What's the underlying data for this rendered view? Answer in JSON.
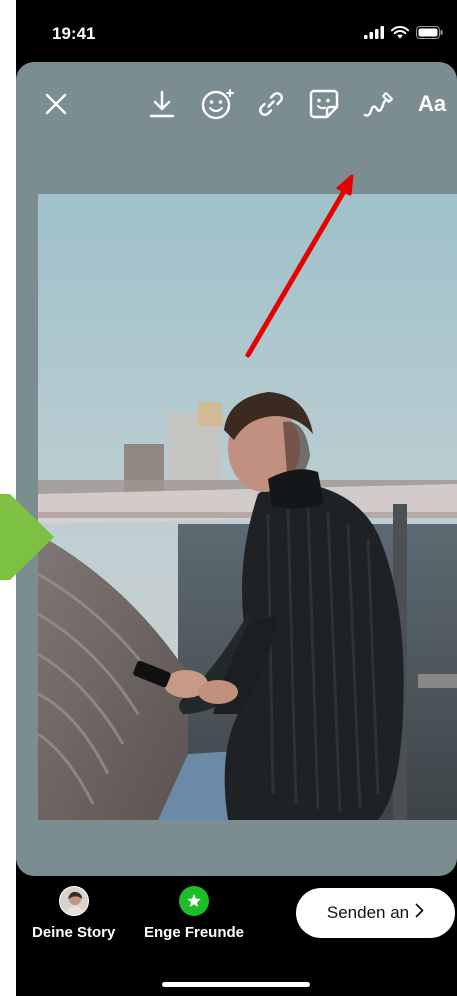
{
  "status_bar": {
    "time": "19:41",
    "icons": [
      "signal-icon",
      "wifi-icon",
      "battery-icon"
    ]
  },
  "toolbar": {
    "close_icon": "close-icon",
    "tools": [
      "download-icon",
      "face-effects-icon",
      "link-icon",
      "sticker-icon",
      "draw-icon"
    ],
    "text_label": "Aa"
  },
  "photo": {
    "subject": "story-photo"
  },
  "annotations": {
    "arrow_color": "#e60000",
    "pointer_color": "#7dc142"
  },
  "share": {
    "your_story_label": "Deine Story",
    "close_friends_label": "Enge Freunde",
    "send_label": "Senden an",
    "send_chevron": "›"
  },
  "colors": {
    "editor_bg": "#7b8d91",
    "close_friends_green": "#1ebd28"
  }
}
